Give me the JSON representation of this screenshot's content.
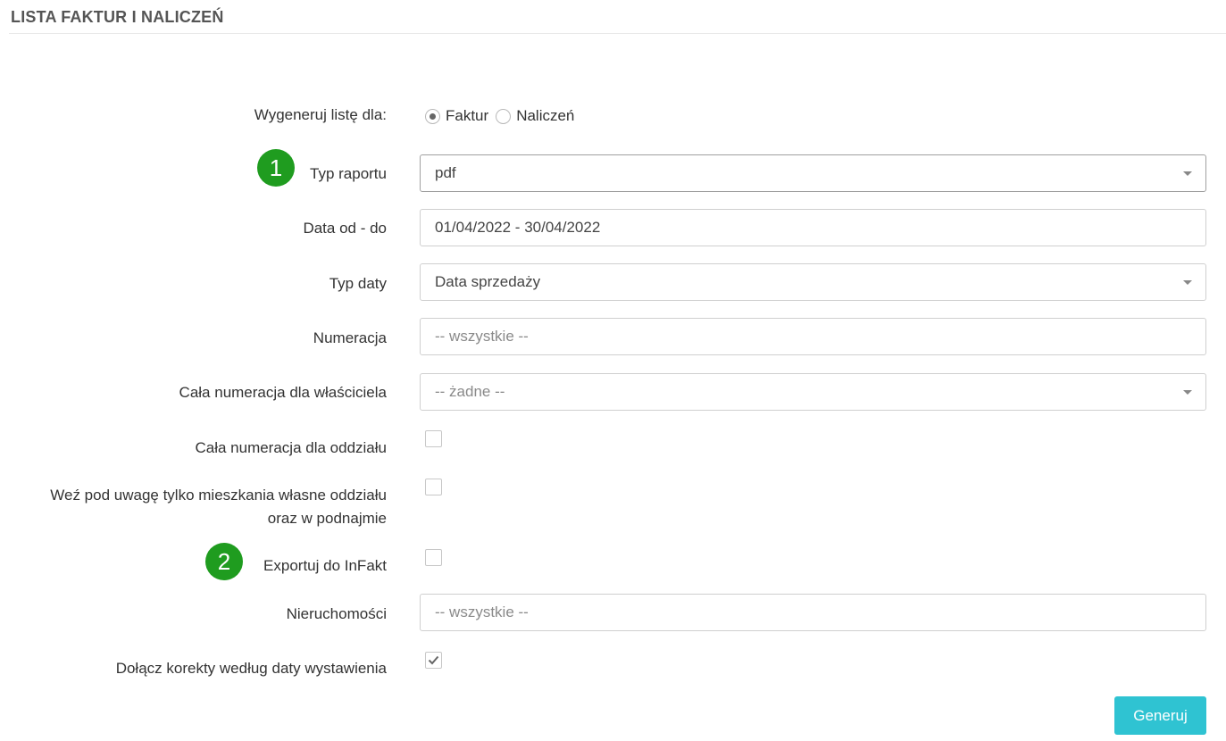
{
  "page": {
    "title": "LISTA FAKTUR I NALICZEŃ"
  },
  "form": {
    "generate_for": {
      "label": "Wygeneruj listę dla:",
      "options": [
        "Faktur",
        "Naliczeń"
      ],
      "selected": "Faktur"
    },
    "report_type": {
      "badge": "1",
      "label": "Typ raportu",
      "value": "pdf"
    },
    "date_range": {
      "label": "Data od - do",
      "value": "01/04/2022 - 30/04/2022"
    },
    "date_type": {
      "label": "Typ daty",
      "value": "Data sprzedaży"
    },
    "numbering": {
      "label": "Numeracja",
      "placeholder": "-- wszystkie --"
    },
    "owner_numbering": {
      "label": "Cała numeracja dla właściciela",
      "placeholder": "-- żadne --"
    },
    "branch_numbering": {
      "label": "Cała numeracja dla oddziału",
      "checked": false
    },
    "own_apartments": {
      "label_line1": "Weź pod uwagę tylko mieszkania własne oddziału",
      "label_line2": "oraz w podnajmie",
      "checked": false
    },
    "export_infakt": {
      "badge": "2",
      "label": "Exportuj do InFakt",
      "checked": false
    },
    "properties": {
      "label": "Nieruchomości",
      "placeholder": "-- wszystkie --"
    },
    "include_corrections": {
      "label": "Dołącz korekty według daty wystawienia",
      "checked": true
    },
    "submit": {
      "label": "Generuj"
    }
  },
  "colors": {
    "badge": "#1f9c1f",
    "button": "#2fc3d2",
    "title": "#555555"
  },
  "icons": {
    "caret": "chevron-down-icon",
    "check": "check-icon"
  }
}
